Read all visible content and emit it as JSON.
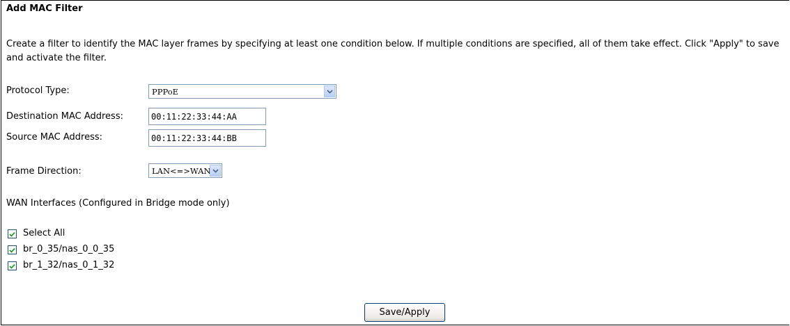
{
  "title": "Add MAC Filter",
  "description": "Create a filter to identify the MAC layer frames by specifying at least one condition below. If multiple conditions are specified, all of them take effect. Click \"Apply\" to save and activate the filter.",
  "protocol": {
    "label": "Protocol Type:",
    "value": "PPPoE"
  },
  "dest_mac": {
    "label": "Destination MAC Address:",
    "value": "00:11:22:33:44:AA"
  },
  "src_mac": {
    "label": "Source MAC Address:",
    "value": "00:11:22:33:44:BB"
  },
  "direction": {
    "label": "Frame Direction:",
    "value": "LAN<=>WAN"
  },
  "wan_heading": "WAN Interfaces (Configured in Bridge mode only)",
  "interfaces": [
    {
      "label": "Select All",
      "checked": true
    },
    {
      "label": "br_0_35/nas_0_0_35",
      "checked": true
    },
    {
      "label": "br_1_32/nas_0_1_32",
      "checked": true
    }
  ],
  "save_label": "Save/Apply",
  "icons": {
    "dropdown": "chevron-down-icon",
    "check": "checkmark-icon"
  }
}
